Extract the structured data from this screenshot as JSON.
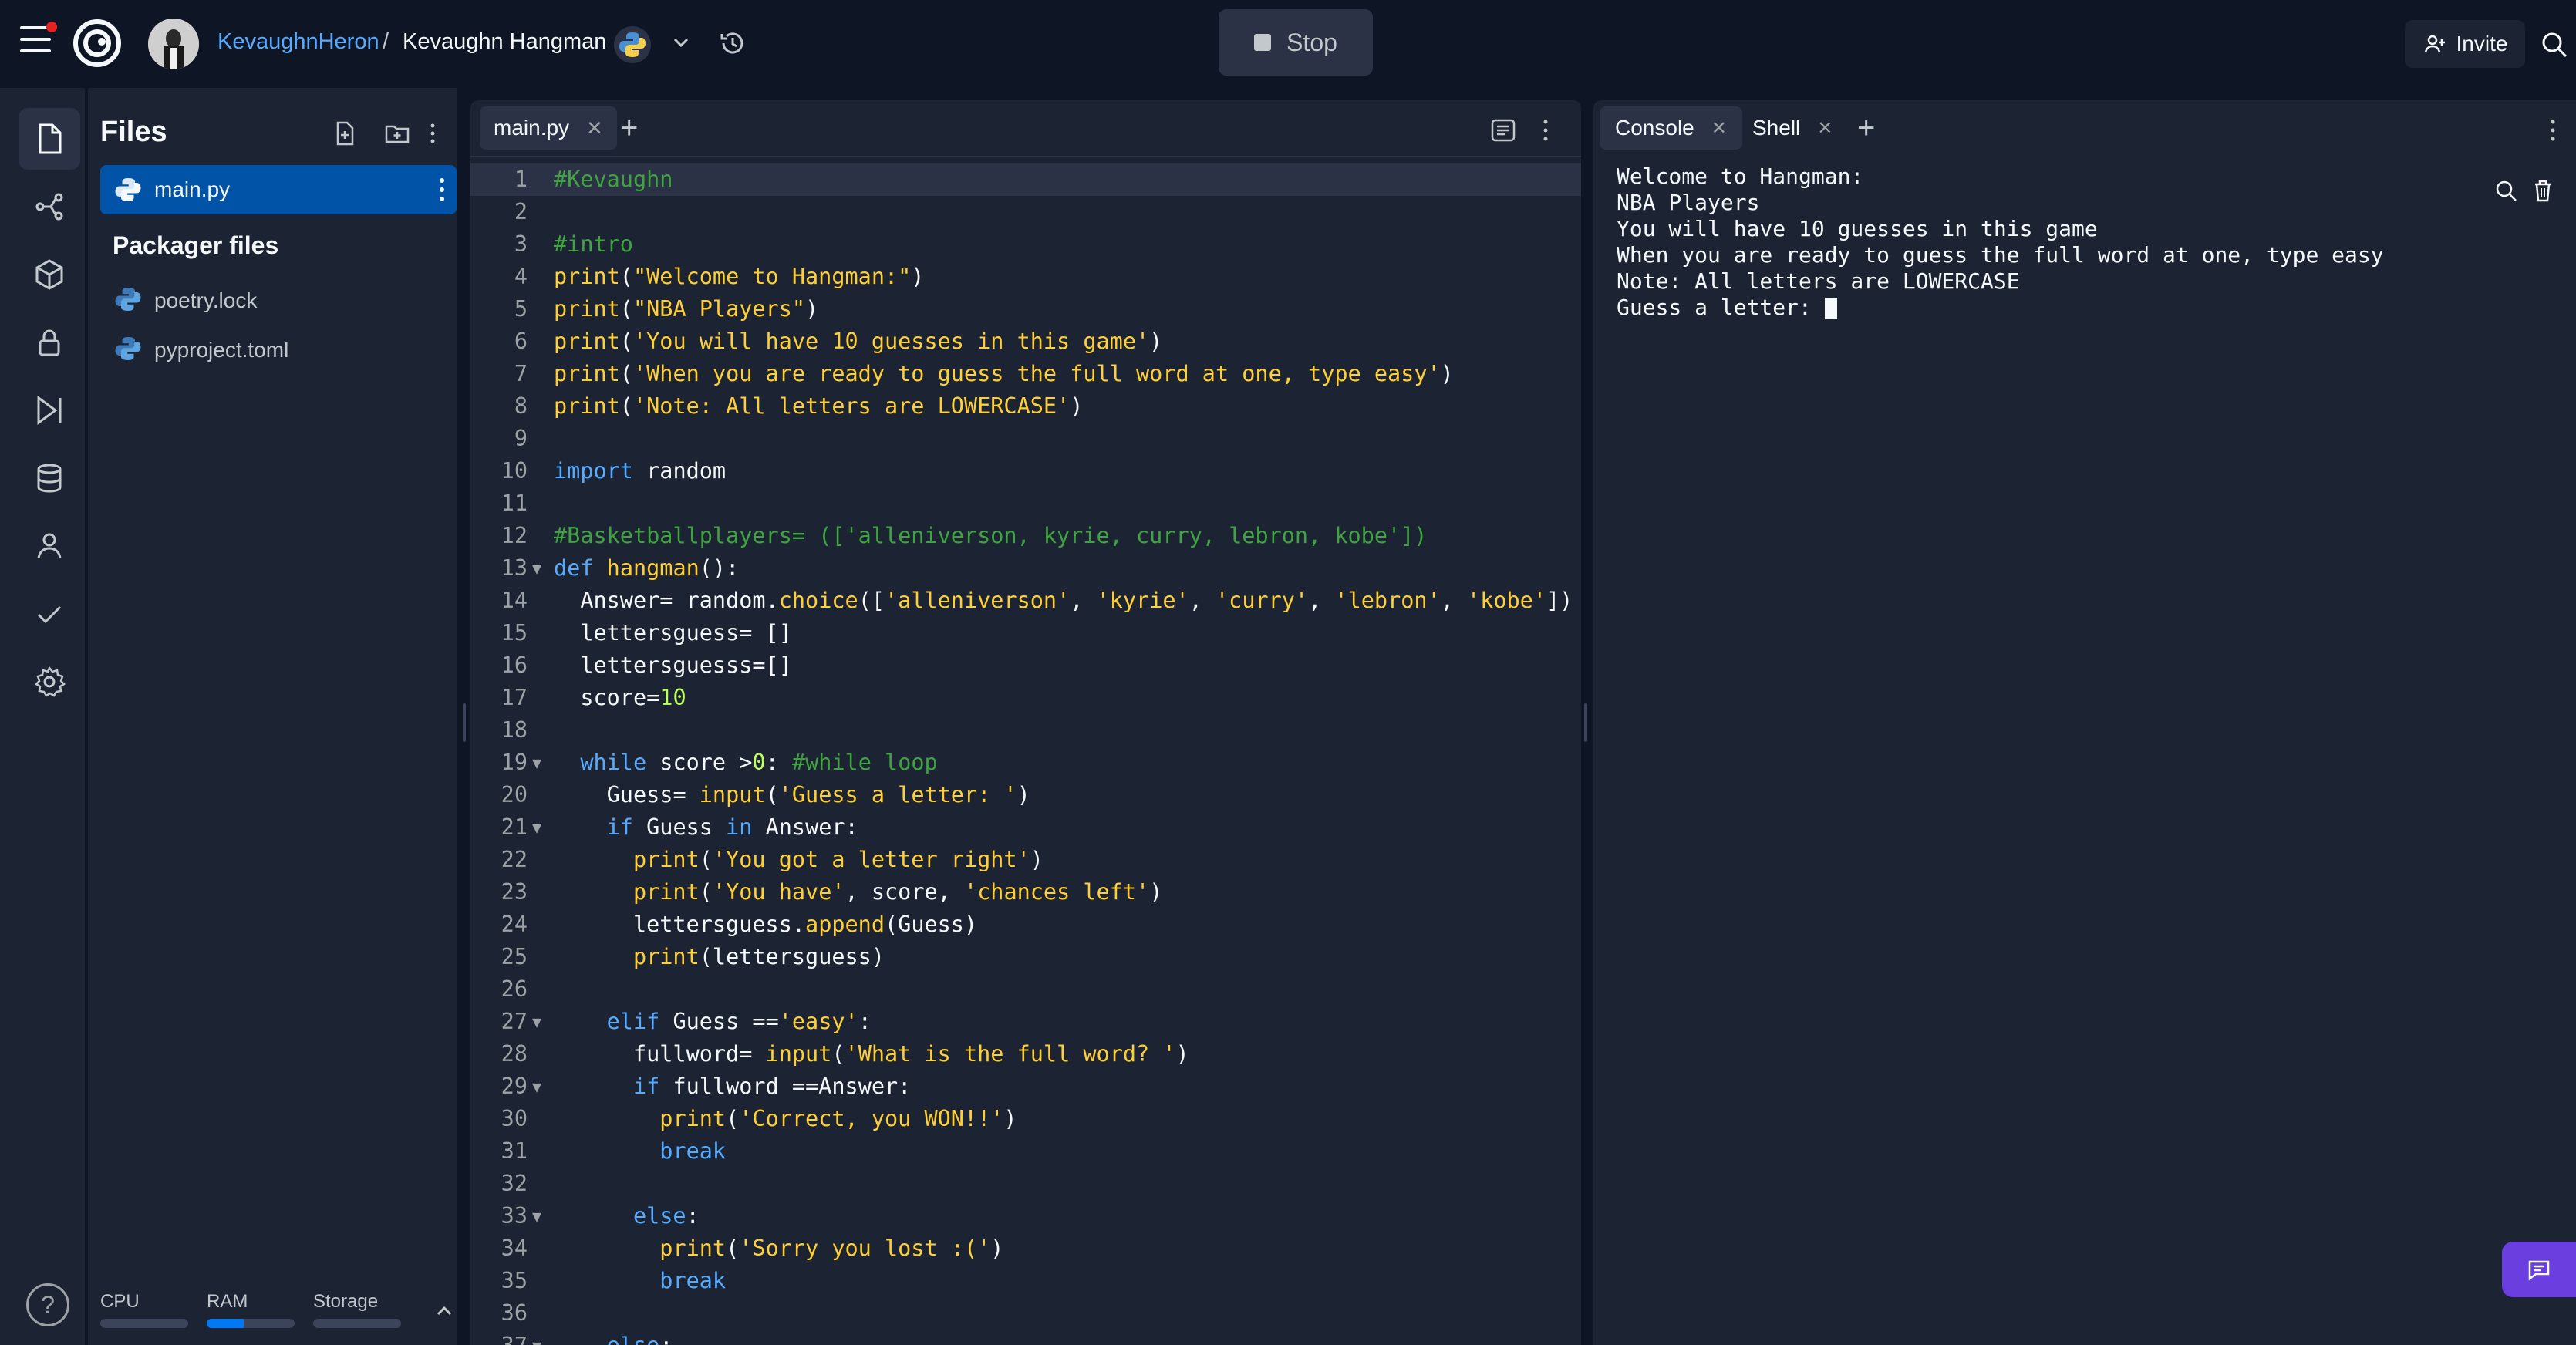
{
  "header": {
    "user": "KevaughnHeron",
    "separator": "/",
    "repl_name": "Kevaughn Hangman",
    "stop_label": "Stop",
    "invite_label": "Invite"
  },
  "rail": {
    "icons": [
      "files-icon",
      "git-icon",
      "packages-icon",
      "secrets-icon",
      "run-icon",
      "database-icon",
      "user-icon",
      "check-icon",
      "settings-icon"
    ],
    "help": "?"
  },
  "files": {
    "title": "Files",
    "active_file": "main.py",
    "packager_title": "Packager files",
    "packager_files": [
      "poetry.lock",
      "pyproject.toml"
    ],
    "usage": {
      "cpu_label": "CPU",
      "ram_label": "RAM",
      "storage_label": "Storage",
      "cpu": 0.0,
      "ram": 0.42,
      "storage": 0.0
    }
  },
  "editor": {
    "tab_label": "main.py",
    "lines": [
      "#Kevaughn",
      "",
      "#intro",
      "print(\"Welcome to Hangman:\")",
      "print(\"NBA Players\")",
      "print('You will have 10 guesses in this game')",
      "print('When you are ready to guess the full word at one, type easy')",
      "print('Note: All letters are LOWERCASE')",
      "",
      "import random",
      "",
      "#Basketballplayers= (['alleniverson, kyrie, curry, lebron, kobe'])",
      "def hangman():",
      "  Answer= random.choice(['alleniverson', 'kyrie', 'curry', 'lebron', 'kobe'])",
      "  lettersguess= []",
      "  lettersguesss=[]",
      "  score=10",
      "",
      "  while score >0: #while loop",
      "    Guess= input('Guess a letter: ')",
      "    if Guess in Answer:",
      "      print('You got a letter right')",
      "      print('You have', score, 'chances left')",
      "      lettersguess.append(Guess)",
      "      print(lettersguess)",
      "",
      "    elif Guess =='easy':",
      "      fullword= input('What is the full word? ')",
      "      if fullword ==Answer:",
      "        print('Correct, you WON!!')",
      "        break",
      "",
      "      else:",
      "        print('Sorry you lost :(')",
      "        break",
      "",
      "    else:"
    ]
  },
  "console": {
    "tabs": [
      "Console",
      "Shell"
    ],
    "output": [
      "Welcome to Hangman:",
      "NBA Players",
      "You will have 10 guesses in this game",
      "When you are ready to guess the full word at one, type easy",
      "Note: All letters are LOWERCASE",
      "Guess a letter: "
    ]
  }
}
